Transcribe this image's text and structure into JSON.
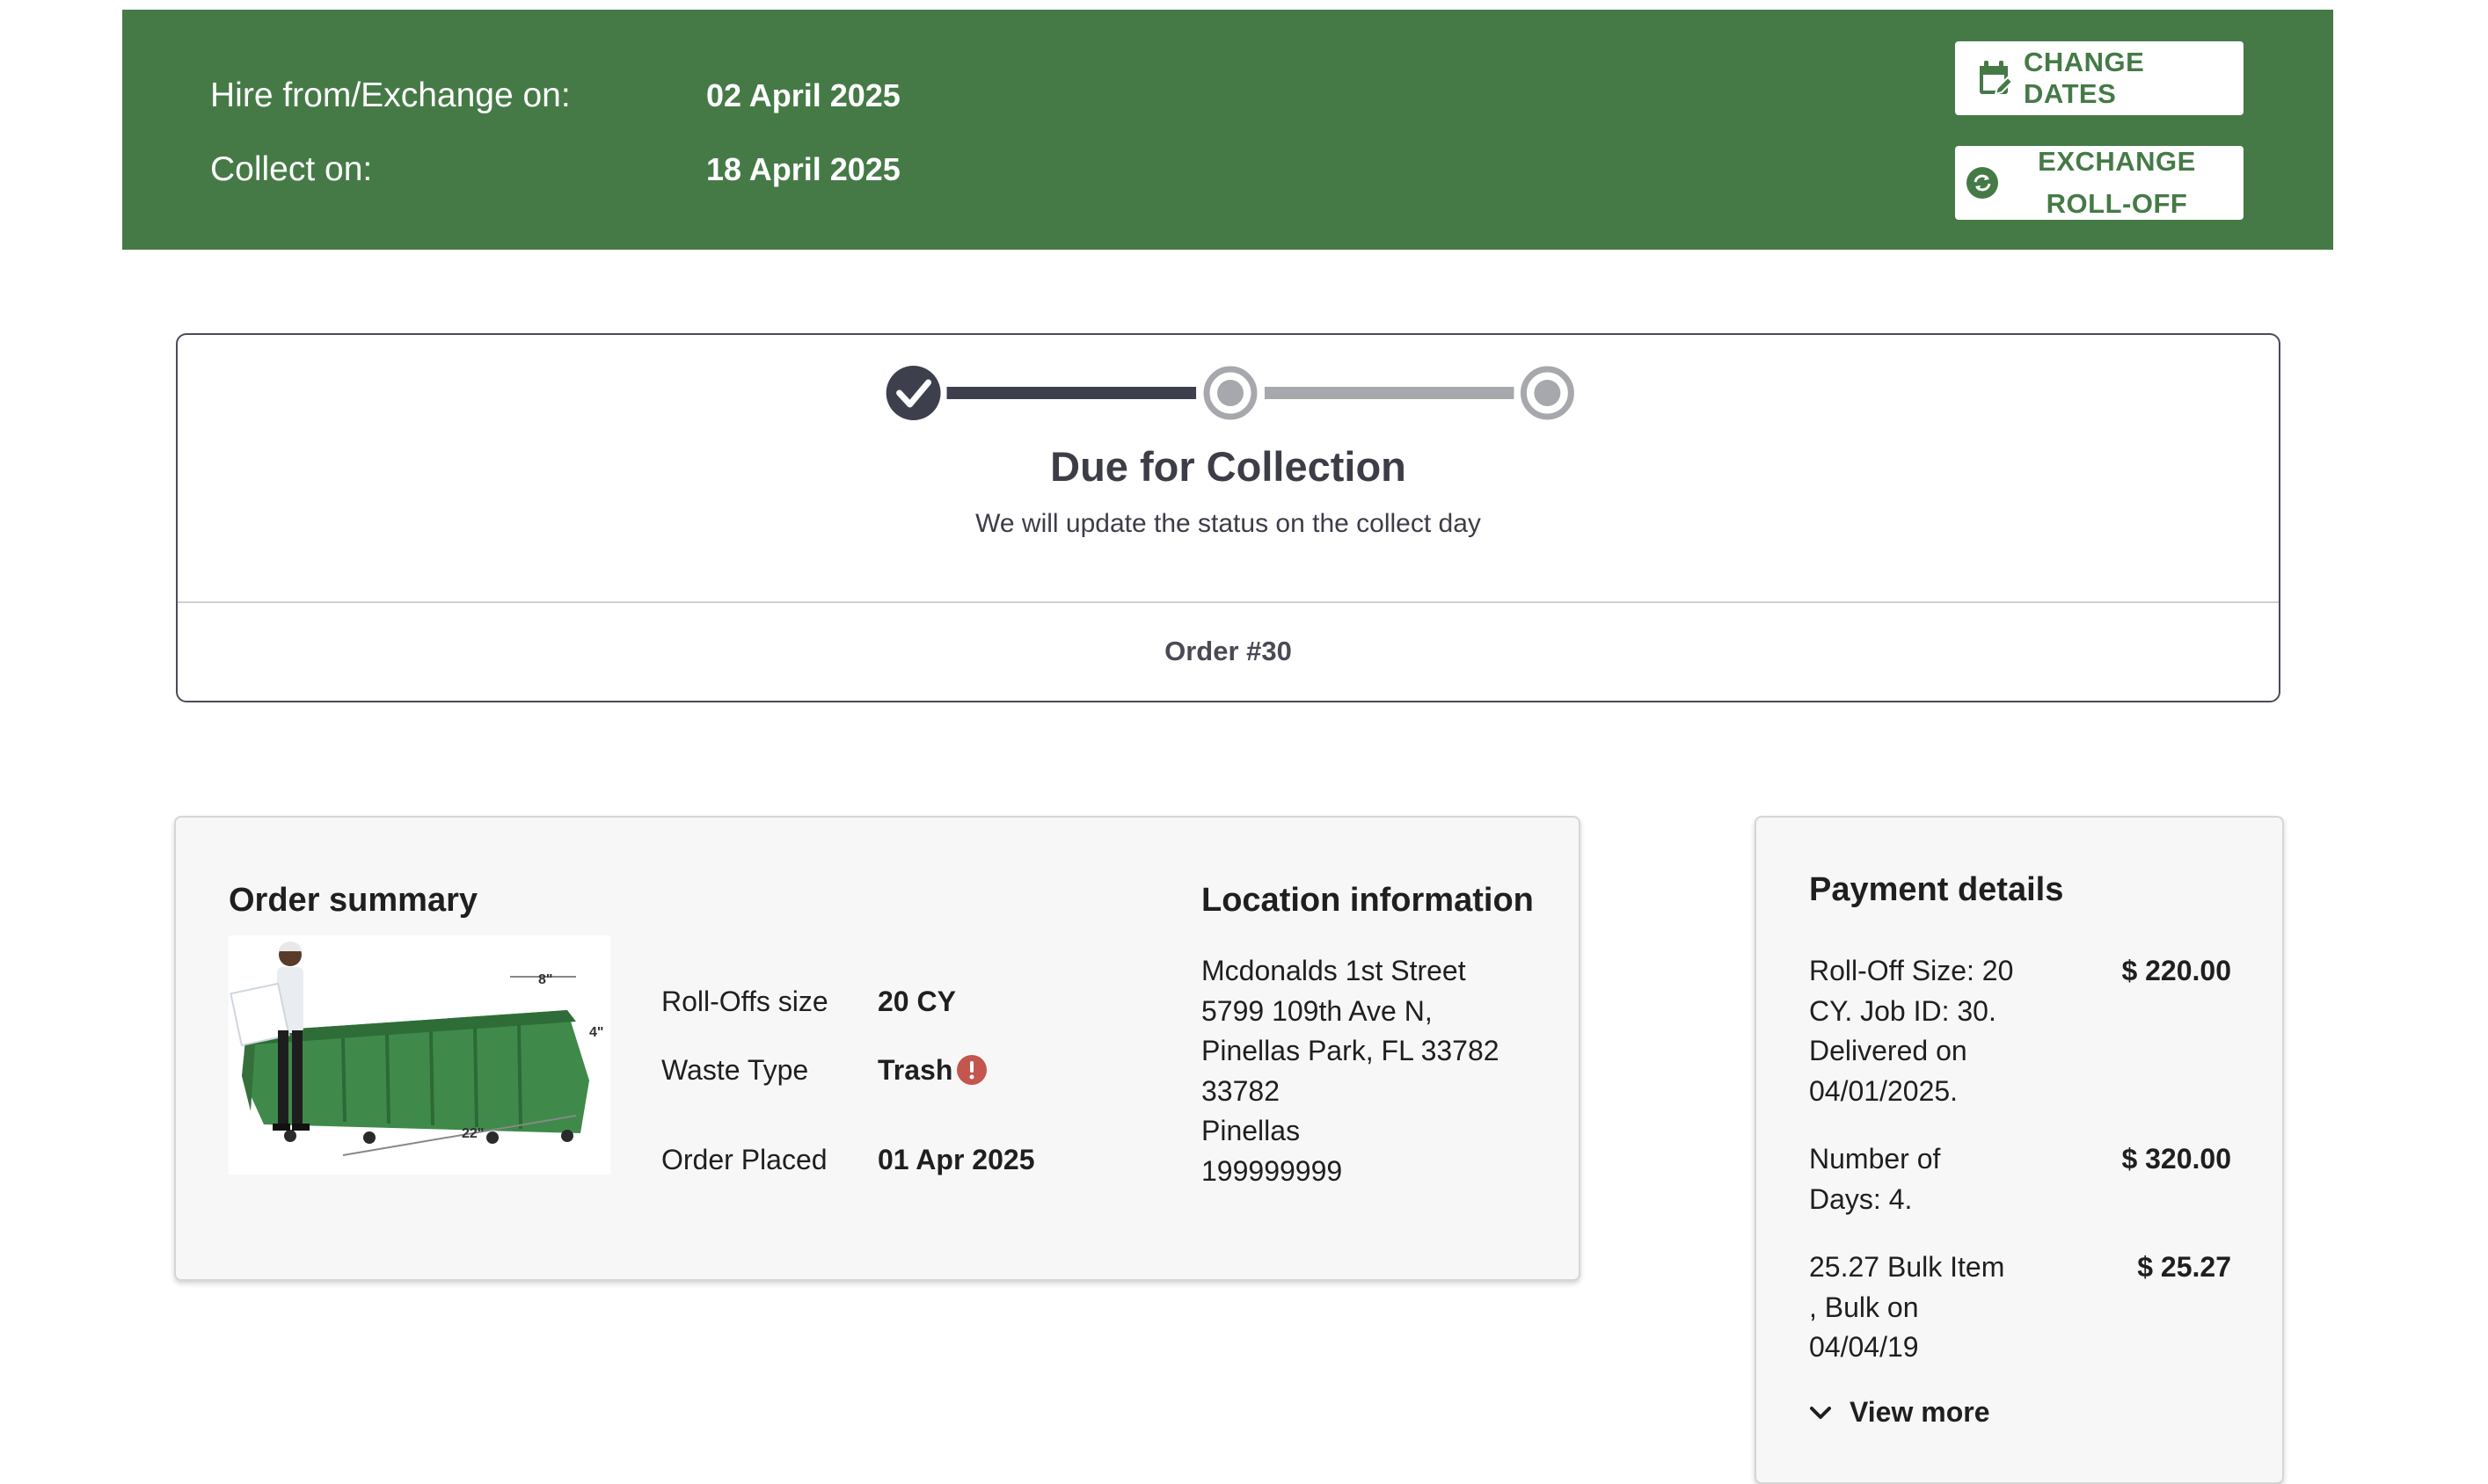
{
  "header": {
    "hire_label": "Hire from/Exchange on:",
    "hire_date": "02 April 2025",
    "collect_label": "Collect on:",
    "collect_date": "18 April 2025",
    "change_dates_label": "CHANGE DATES",
    "exchange_label_line1": "EXCHANGE",
    "exchange_label_line2": "ROLL-OFF",
    "banner_color": "#457a47"
  },
  "status": {
    "steps_total": 3,
    "steps_completed": 1,
    "title": "Due for Collection",
    "subtitle": "We will update the status on the collect day",
    "order_number": "Order #30"
  },
  "order_summary": {
    "heading": "Order summary",
    "image_icon": "roll-off-dumpster-image",
    "image_dims": {
      "top": "8\"",
      "side": "4\"",
      "length": "22\""
    },
    "specs": [
      {
        "label": "Roll-Offs size",
        "value": "20 CY"
      },
      {
        "label": "Waste Type",
        "value": "Trash",
        "icon": "warning-icon"
      },
      {
        "label": "Order Placed",
        "value": "01 Apr 2025"
      }
    ]
  },
  "location": {
    "heading": "Location information",
    "lines": [
      "Mcdonalds 1st Street",
      "5799 109th Ave N,",
      "Pinellas Park, FL 33782",
      "33782",
      "Pinellas",
      "199999999"
    ]
  },
  "payment": {
    "heading": "Payment details",
    "items": [
      {
        "desc_lines": [
          "Roll-Off Size: 20",
          "CY. Job ID: 30.",
          "Delivered on",
          "04/01/2025."
        ],
        "amount": "$ 220.00"
      },
      {
        "desc_lines": [
          "Number of",
          "Days: 4."
        ],
        "amount": "$ 320.00"
      },
      {
        "desc_lines": [
          "25.27 Bulk Item",
          ", Bulk on",
          "04/04/19"
        ],
        "amount": "$ 25.27"
      }
    ],
    "view_more": "View more"
  }
}
